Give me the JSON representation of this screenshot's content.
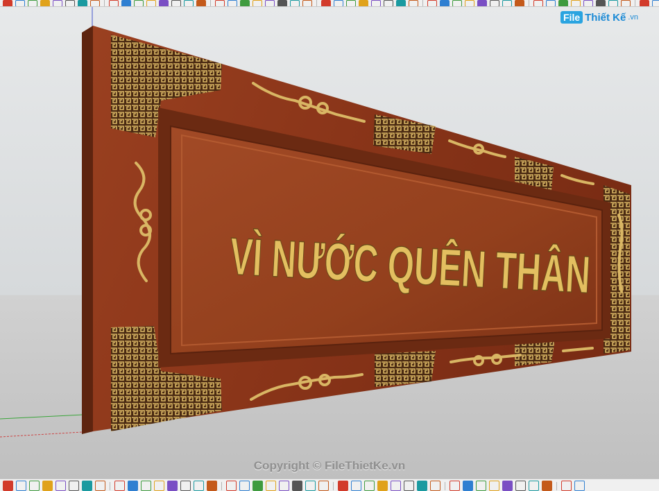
{
  "app": {
    "watermark_logo": {
      "badge": "File",
      "word": "Thiết Kế",
      "ext": ".vn"
    },
    "copyright": "Copyright © FileThietKe.vn"
  },
  "model": {
    "plaque_text": "VÌ NƯỚC QUÊN THÂN",
    "wood_color": "#8e3a1c",
    "gold_color": "#d9b664",
    "letter_color": "#e9c76a"
  },
  "toolbar": {
    "top_tools": [
      "new-icon",
      "open-icon",
      "save-icon",
      "cut-icon",
      "copy-icon",
      "paste-icon",
      "erase-icon",
      "undo-icon",
      "redo-icon",
      "print-icon",
      "model-info-icon",
      "select-icon",
      "component-icon",
      "paint-icon",
      "eraser-icon",
      "rectangle-icon",
      "line-icon",
      "arc-icon",
      "polygon-icon",
      "freehand-icon",
      "move-icon",
      "pushpull-icon",
      "rotate-icon",
      "followme-icon",
      "scale-icon",
      "offset-icon",
      "tape-icon",
      "dimension-icon",
      "protractor-icon",
      "text-icon",
      "axes-icon",
      "3dtext-icon",
      "orbit-icon",
      "pan-icon",
      "zoom-icon",
      "zoom-window-icon",
      "zoom-extents-icon",
      "previous-icon",
      "next-icon",
      "standard-views-icon",
      "xray-icon",
      "wireframe-icon",
      "hidden-line-icon",
      "shaded-icon",
      "textures-icon",
      "monochrome-icon",
      "layer-icon",
      "section-icon",
      "shadow-icon",
      "fog-icon"
    ],
    "bottom_tools": [
      "select-icon",
      "make-component-icon",
      "eraser-icon",
      "paint-bucket-icon",
      "line-icon",
      "rectangle-icon",
      "rotated-rect-icon",
      "circle-icon",
      "polygon-icon",
      "arc-icon",
      "pie-icon",
      "push-pull-icon",
      "follow-me-icon",
      "pencil-icon",
      "move-icon",
      "offset-icon",
      "tape-icon",
      "text-icon",
      "dimension-icon",
      "3d-text-icon",
      "solid-union-icon",
      "solid-subtract-icon",
      "solid-trim-icon",
      "intersect-icon",
      "split-icon",
      "shell-icon",
      "section-plane-icon",
      "orbit-icon",
      "pan-icon",
      "zoom-icon",
      "zoom-extents-icon",
      "walk-icon",
      "look-around-icon",
      "position-camera-icon",
      "sandbox-icon",
      "stamp-icon",
      "drape-icon",
      "flip-edge-icon",
      "smoove-icon",
      "add-detail-icon",
      "warehouse-icon",
      "extension-icon"
    ]
  }
}
